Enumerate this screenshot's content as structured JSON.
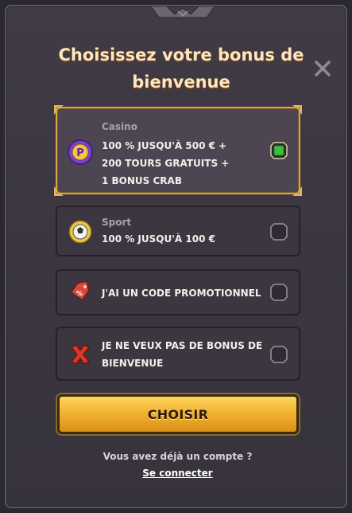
{
  "modal": {
    "title": "Choisissez votre bonus de bienvenue",
    "options": [
      {
        "category": "Casino",
        "lines": [
          "100 % JUSQU'À 500 € +",
          "200 TOURS GRATUITS +",
          "1 BONUS CRAB"
        ],
        "selected": true,
        "icon": "casino-dice-icon"
      },
      {
        "category": "Sport",
        "lines": [
          "100 % JUSQU'À 100 €"
        ],
        "selected": false,
        "icon": "soccer-ball-icon"
      },
      {
        "category": "",
        "lines": [
          "J'AI UN CODE PROMOTIONNEL"
        ],
        "selected": false,
        "icon": "promo-tag-icon"
      },
      {
        "category": "",
        "lines": [
          "JE NE VEUX PAS DE BONUS DE",
          "BIENVENUE"
        ],
        "selected": false,
        "icon": "red-cross-icon"
      }
    ],
    "choose_label": "CHOISIR",
    "account_question": "Vous avez déjà un compte ?",
    "login_link": "Se connecter"
  },
  "colors": {
    "accent_gold": "#d8a64a",
    "button_gold": "#f3b431",
    "selected_radio": "#3fbf3f"
  }
}
